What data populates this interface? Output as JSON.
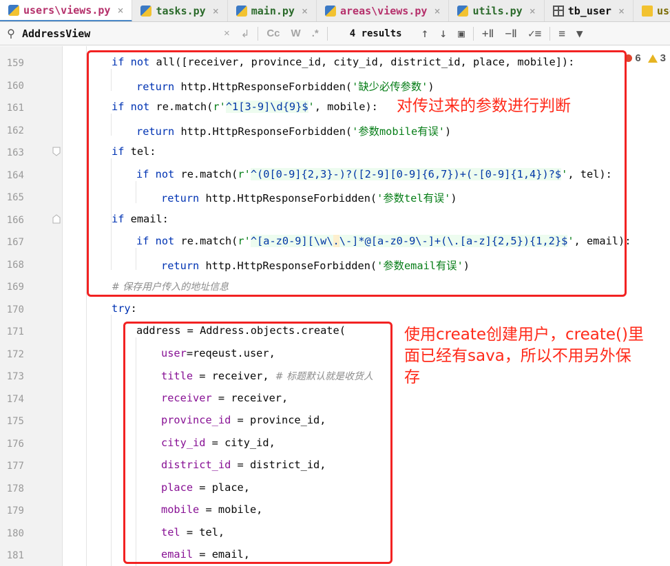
{
  "tabs": [
    {
      "label": "users\\views.py",
      "icon": "python-file-icon",
      "active": true,
      "closable": true
    },
    {
      "label": "tasks.py",
      "icon": "python-file-icon",
      "active": false,
      "closable": true
    },
    {
      "label": "main.py",
      "icon": "python-file-icon",
      "active": false,
      "closable": true
    },
    {
      "label": "areas\\views.py",
      "icon": "python-file-icon",
      "active": false,
      "closable": true
    },
    {
      "label": "utils.py",
      "icon": "python-file-icon",
      "active": false,
      "closable": true
    },
    {
      "label": "tb_user",
      "icon": "table-icon",
      "active": false,
      "closable": true
    },
    {
      "label": "user",
      "icon": "js-file-icon",
      "active": false,
      "closable": false
    }
  ],
  "search": {
    "query": "AddressView",
    "results": "4 results",
    "case_label": "Cc",
    "words_label": "W",
    "regex_label": ".*"
  },
  "inspection": {
    "errors": "6",
    "warnings": "3"
  },
  "editor": {
    "lines": [
      {
        "num": "159",
        "a": "if",
        "b": " ",
        "c": "not",
        "d": " all([receiver, province_id, city_id, district_id, place, mobile]):"
      },
      {
        "num": "160",
        "a": "return",
        "b": " http.HttpResponseForbidden(",
        "c": "'缺少必传参数'",
        "d": ")"
      },
      {
        "num": "161",
        "a": "if",
        "b": " ",
        "c": "not",
        "d": " re.match(",
        "e": "r'",
        "f": "^1[3-9]\\d{9}$",
        "g": "'",
        "h": ", mobile):"
      },
      {
        "num": "162",
        "a": "return",
        "b": " http.HttpResponseForbidden(",
        "c": "'参数mobile有误'",
        "d": ")"
      },
      {
        "num": "163",
        "a": "if",
        "b": " tel:"
      },
      {
        "num": "164",
        "a": "if",
        "b": " ",
        "c": "not",
        "d": " re.match(",
        "e": "r'",
        "f": "^(0[0-9]{2,3}-)?([2-9][0-9]{6,7})+(-[0-9]{1,4})?$",
        "g": "'",
        "h": ", tel):"
      },
      {
        "num": "165",
        "a": "return",
        "b": " http.HttpResponseForbidden(",
        "c": "'参数tel有误'",
        "d": ")"
      },
      {
        "num": "166",
        "a": "if",
        "b": " email:"
      },
      {
        "num": "167",
        "a": "if",
        "b": " ",
        "c": "not",
        "d": " re.match(",
        "e": "r'",
        "f1": "^[a-z0-9][\\w\\",
        "f2": ".",
        "f3": "\\-]*@[a-z0-9\\-]+(\\.[a-z]{2,5}){1,2}$",
        "g": "'",
        "h": ", email):"
      },
      {
        "num": "168",
        "a": "return",
        "b": " http.HttpResponseForbidden(",
        "c": "'参数email有误'",
        "d": ")"
      },
      {
        "num": "169",
        "a": "# 保存用户传入的地址信息"
      },
      {
        "num": "170",
        "a": "try",
        "b": ":"
      },
      {
        "num": "171",
        "a": "address = Address.objects.create("
      },
      {
        "num": "172",
        "a": "user",
        "b": "=reqeust.user,"
      },
      {
        "num": "173",
        "a": "title",
        "b": " = receiver, ",
        "c": "# 标题默认就是收货人"
      },
      {
        "num": "174",
        "a": "receiver",
        "b": " = receiver,"
      },
      {
        "num": "175",
        "a": "province_id",
        "b": " = province_id,"
      },
      {
        "num": "176",
        "a": "city_id",
        "b": " = city_id,"
      },
      {
        "num": "177",
        "a": "district_id",
        "b": " = district_id,"
      },
      {
        "num": "178",
        "a": "place",
        "b": " = place,"
      },
      {
        "num": "179",
        "a": "mobile",
        "b": " = mobile,"
      },
      {
        "num": "180",
        "a": "tel",
        "b": " = tel,"
      },
      {
        "num": "181",
        "a": "email",
        "b": " = email,"
      }
    ]
  },
  "annotations": {
    "validation_note": "对传过来的参数进行判断",
    "create_note_line1": "使用create创建用户，create()里",
    "create_note_line2": "面已经有sava，所以不用另外保",
    "create_note_line3": "存"
  },
  "colors": {
    "keyword": "#0033b3",
    "string": "#067d17",
    "param": "#871094",
    "comment": "#8c8c8c",
    "annotation": "#ff2a1a"
  }
}
